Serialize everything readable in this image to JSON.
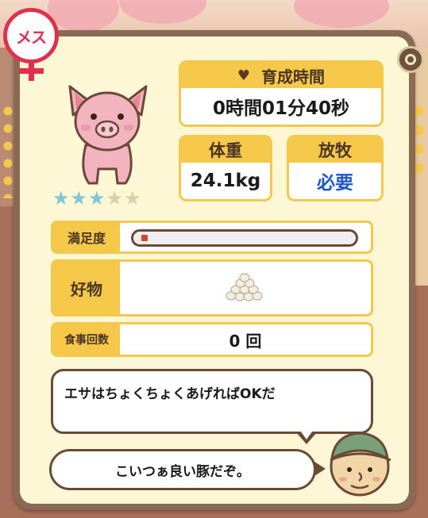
{
  "gender_badge": {
    "label": "メス",
    "color": "#e0304e"
  },
  "pig": {
    "rating": 3,
    "max_rating": 5,
    "stars": [
      "★",
      "★",
      "★",
      "★",
      "★"
    ]
  },
  "growth_time": {
    "label": "育成時間",
    "value": "0時間01分40秒"
  },
  "weight": {
    "label": "体重",
    "value": "24.1kg"
  },
  "grazing": {
    "label": "放牧",
    "value": "必要"
  },
  "satisfaction": {
    "label": "満足度",
    "level": 0.03
  },
  "favorite": {
    "label": "好物",
    "icon": "grain-pile-icon"
  },
  "meals": {
    "label": "食事回数",
    "value": "0 回"
  },
  "dialog": {
    "hint": "エサはちょくちょくあげればOKだ",
    "comment": "こいつぁ良い豚だぞ。"
  },
  "colors": {
    "accent": "#f5c84a",
    "frame": "#8a6a52",
    "panel": "#fdf7d6",
    "link_blue": "#1d58c8"
  }
}
